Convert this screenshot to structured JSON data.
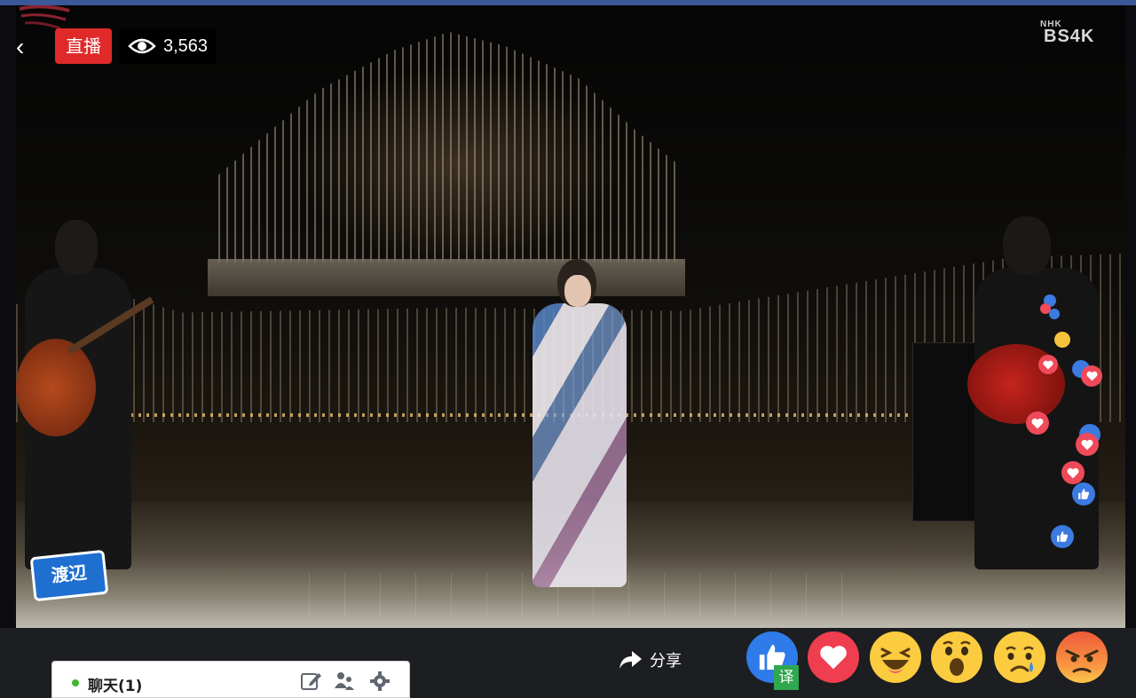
{
  "video": {
    "live_label": "直播",
    "viewer_count": "3,563",
    "broadcaster_mark": "NHK",
    "broadcaster_channel": "BS4K",
    "watermark_text": "渡辺"
  },
  "chat": {
    "label": "聊天(1)",
    "status_color": "#42b72a"
  },
  "actions": {
    "share_label": "分享",
    "translate_badge": "译"
  },
  "reactions": [
    {
      "name": "like",
      "color": "#2f7bea"
    },
    {
      "name": "love",
      "color": "#ef3e4f"
    },
    {
      "name": "haha",
      "color": "#fbcc3f"
    },
    {
      "name": "wow",
      "color": "#fbcc3f"
    },
    {
      "name": "sad",
      "color": "#fbcc3f"
    },
    {
      "name": "angry",
      "color": "#ee5a3a"
    }
  ],
  "colors": {
    "top_bar": "#3b5998",
    "live_badge": "#e02a2a"
  }
}
